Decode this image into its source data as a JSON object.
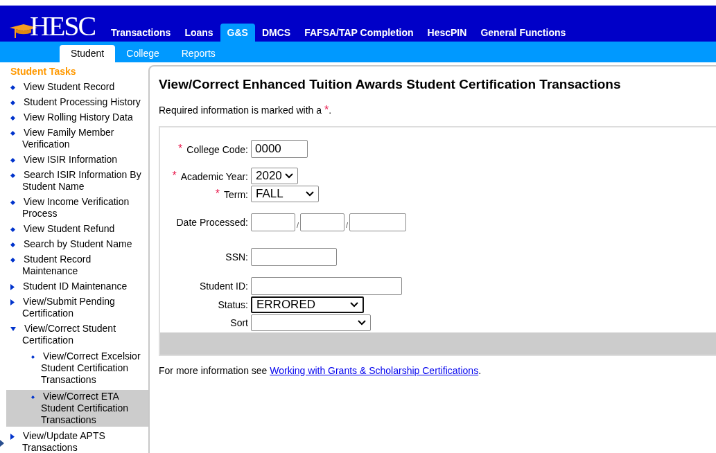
{
  "header": {
    "logo": "HESC",
    "tabs": [
      {
        "label": "Transactions",
        "selected": false
      },
      {
        "label": "Loans",
        "selected": false
      },
      {
        "label": "G&S",
        "selected": true
      },
      {
        "label": "DMCS",
        "selected": false
      },
      {
        "label": "FAFSA/TAP Completion",
        "selected": false
      },
      {
        "label": "HescPIN",
        "selected": false
      },
      {
        "label": "General Functions",
        "selected": false
      }
    ],
    "subtabs": [
      {
        "label": "Student",
        "selected": true
      },
      {
        "label": "College",
        "selected": false
      },
      {
        "label": "Reports",
        "selected": false
      }
    ]
  },
  "sidebar": {
    "heading": "Student Tasks",
    "items": [
      {
        "label": "View Student Record",
        "kind": "bullet",
        "selected": false
      },
      {
        "label": "Student Processing History",
        "kind": "bullet",
        "selected": false
      },
      {
        "label": "View Rolling History Data",
        "kind": "bullet",
        "selected": false
      },
      {
        "label": "View Family Member Verification",
        "kind": "bullet",
        "selected": false
      },
      {
        "label": "View ISIR Information",
        "kind": "bullet",
        "selected": false
      },
      {
        "label": "Search ISIR Information By Student Name",
        "kind": "bullet",
        "selected": false
      },
      {
        "label": "View Income Verification Process",
        "kind": "bullet",
        "selected": false
      },
      {
        "label": "View Student Refund",
        "kind": "bullet",
        "selected": false
      },
      {
        "label": "Search by Student Name",
        "kind": "bullet",
        "selected": false
      },
      {
        "label": "Student Record Maintenance",
        "kind": "bullet",
        "selected": false
      },
      {
        "label": "Student ID Maintenance",
        "kind": "folder",
        "expanded": false,
        "selected": false
      },
      {
        "label": "View/Submit Pending Certification",
        "kind": "folder",
        "expanded": false,
        "selected": false
      },
      {
        "label": "View/Correct Student Certification",
        "kind": "folder",
        "expanded": true,
        "selected": false,
        "children": [
          {
            "label": "View/Correct Excelsior Student Certification Transactions",
            "kind": "bullet",
            "selected": false
          },
          {
            "label": "View/Correct ETA Student Certification Transactions",
            "kind": "bullet",
            "selected": true
          }
        ]
      },
      {
        "label": "View/Update APTS Transactions",
        "kind": "folder",
        "expanded": false,
        "selected": false
      }
    ]
  },
  "main": {
    "title": "View/Correct Enhanced Tuition Awards Student Certification Transactions",
    "required_note": {
      "text": "Required information is marked with a",
      "asterisk": "*",
      "end": "."
    },
    "fields": [
      {
        "label": "College Code:",
        "asterisk": "*",
        "kind": "text",
        "value": "0000"
      },
      {
        "label": "Academic Year:",
        "asterisk": "*",
        "kind": "select",
        "value": "2020",
        "focused": false
      },
      {
        "label": "Term:",
        "asterisk": "*",
        "kind": "select",
        "value": "FALL",
        "focused": false
      },
      {
        "label": "Date Processed:",
        "kind": "date",
        "parts": [
          {
            "kind": "box"
          },
          {
            "kind": "separator",
            "text": "/"
          },
          {
            "kind": "box"
          },
          {
            "kind": "separator",
            "text": "/"
          },
          {
            "kind": "box"
          }
        ]
      },
      {
        "label": "SSN:",
        "kind": "text"
      },
      {
        "label": "Student ID:",
        "kind": "text"
      },
      {
        "label": "Status:",
        "kind": "select",
        "value": "ERRORED",
        "focused": true
      },
      {
        "label": "Sort",
        "kind": "select",
        "focused": false
      }
    ],
    "footer": {
      "text": "For more information see",
      "link": "Working with Grants & Scholarship Certifications",
      "end": "."
    }
  }
}
